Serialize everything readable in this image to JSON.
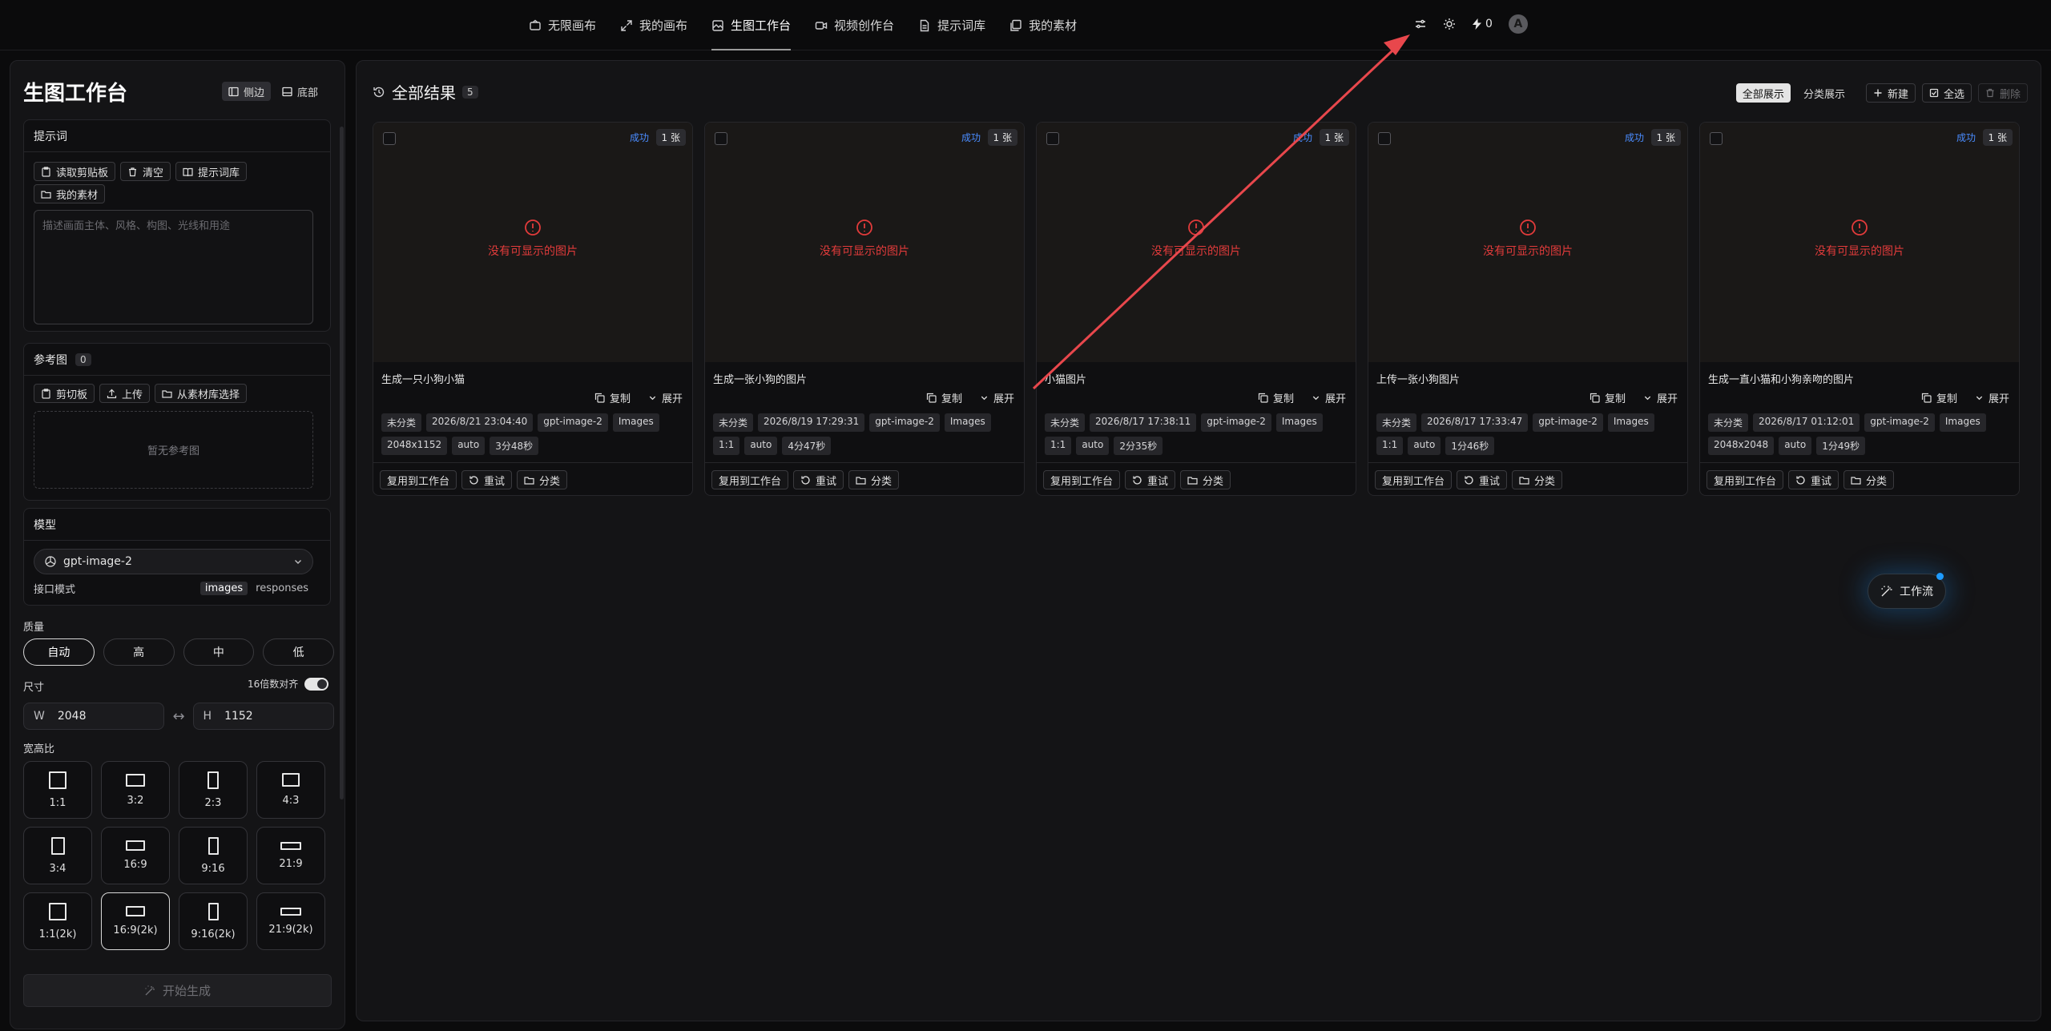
{
  "nav": {
    "items": [
      {
        "label": "无限画布",
        "icon": "canvas-icon"
      },
      {
        "label": "我的画布",
        "icon": "expand-icon"
      },
      {
        "label": "生图工作台",
        "icon": "image-icon",
        "active": true
      },
      {
        "label": "视频创作台",
        "icon": "video-icon"
      },
      {
        "label": "提示词库",
        "icon": "document-icon"
      },
      {
        "label": "我的素材",
        "icon": "gallery-icon"
      }
    ],
    "credits": "0",
    "avatar_letter": "A"
  },
  "left": {
    "title": "生图工作台",
    "layout_side": "侧边",
    "layout_bottom": "底部",
    "prompt": {
      "header": "提示词",
      "read_clipboard": "读取剪贴板",
      "clear": "清空",
      "prompt_library": "提示词库",
      "my_assets": "我的素材",
      "placeholder": "描述画面主体、风格、构图、光线和用途"
    },
    "reference": {
      "header": "参考图",
      "count": "0",
      "clipboard": "剪切板",
      "upload": "上传",
      "from_library": "从素材库选择",
      "empty": "暂无参考图"
    },
    "model": {
      "header": "模型",
      "selected": "gpt-image-2",
      "api_mode_label": "接口模式",
      "api_modes": [
        "images",
        "responses"
      ],
      "api_mode_active": "images"
    },
    "quality": {
      "label": "质量",
      "options": [
        "自动",
        "高",
        "中",
        "低"
      ],
      "active": "自动"
    },
    "size": {
      "label": "尺寸",
      "snap_label": "16倍数对齐",
      "w_label": "W",
      "w_value": "2048",
      "h_label": "H",
      "h_value": "1152",
      "swap": "↔"
    },
    "ratio": {
      "label": "宽高比",
      "options": [
        "1:1",
        "3:2",
        "2:3",
        "4:3",
        "3:4",
        "16:9",
        "9:16",
        "21:9",
        "1:1(2k)",
        "16:9(2k)",
        "9:16(2k)",
        "21:9(2k)"
      ],
      "active": "16:9(2k)"
    },
    "start_button": "开始生成"
  },
  "main": {
    "title": "全部结果",
    "count": "5",
    "view_all": "全部展示",
    "view_category": "分类展示",
    "new": "新建",
    "select_all": "全选",
    "delete": "删除",
    "cards": [
      {
        "status": "成功",
        "count": "1 张",
        "error": "没有可显示的图片",
        "title": "生成一只小狗小猫",
        "copy": "复制",
        "expand": "展开",
        "tags": [
          "未分类",
          "2026/8/21 23:04:40",
          "gpt-image-2",
          "Images",
          "2048x1152",
          "auto",
          "3分48秒"
        ],
        "reuse": "复用到工作台",
        "retry": "重试",
        "classify": "分类"
      },
      {
        "status": "成功",
        "count": "1 张",
        "error": "没有可显示的图片",
        "title": "生成一张小狗的图片",
        "copy": "复制",
        "expand": "展开",
        "tags": [
          "未分类",
          "2026/8/19 17:29:31",
          "gpt-image-2",
          "Images",
          "1:1",
          "auto",
          "4分47秒"
        ],
        "reuse": "复用到工作台",
        "retry": "重试",
        "classify": "分类"
      },
      {
        "status": "成功",
        "count": "1 张",
        "error": "没有可显示的图片",
        "title": "小猫图片",
        "copy": "复制",
        "expand": "展开",
        "tags": [
          "未分类",
          "2026/8/17 17:38:11",
          "gpt-image-2",
          "Images",
          "1:1",
          "auto",
          "2分35秒"
        ],
        "reuse": "复用到工作台",
        "retry": "重试",
        "classify": "分类"
      },
      {
        "status": "成功",
        "count": "1 张",
        "error": "没有可显示的图片",
        "title": "上传一张小狗图片",
        "copy": "复制",
        "expand": "展开",
        "tags": [
          "未分类",
          "2026/8/17 17:33:47",
          "gpt-image-2",
          "Images",
          "1:1",
          "auto",
          "1分46秒"
        ],
        "reuse": "复用到工作台",
        "retry": "重试",
        "classify": "分类"
      },
      {
        "status": "成功",
        "count": "1 张",
        "error": "没有可显示的图片",
        "title": "生成一直小猫和小狗亲吻的图片",
        "copy": "复制",
        "expand": "展开",
        "tags": [
          "未分类",
          "2026/8/17 01:12:01",
          "gpt-image-2",
          "Images",
          "2048x2048",
          "auto",
          "1分49秒"
        ],
        "reuse": "复用到工作台",
        "retry": "重试",
        "classify": "分类"
      }
    ],
    "fab_label": "工作流"
  },
  "colors": {
    "accent_blue": "#4a8cff",
    "error_red": "#e23b3b",
    "annotation_arrow": "#e8474c"
  }
}
